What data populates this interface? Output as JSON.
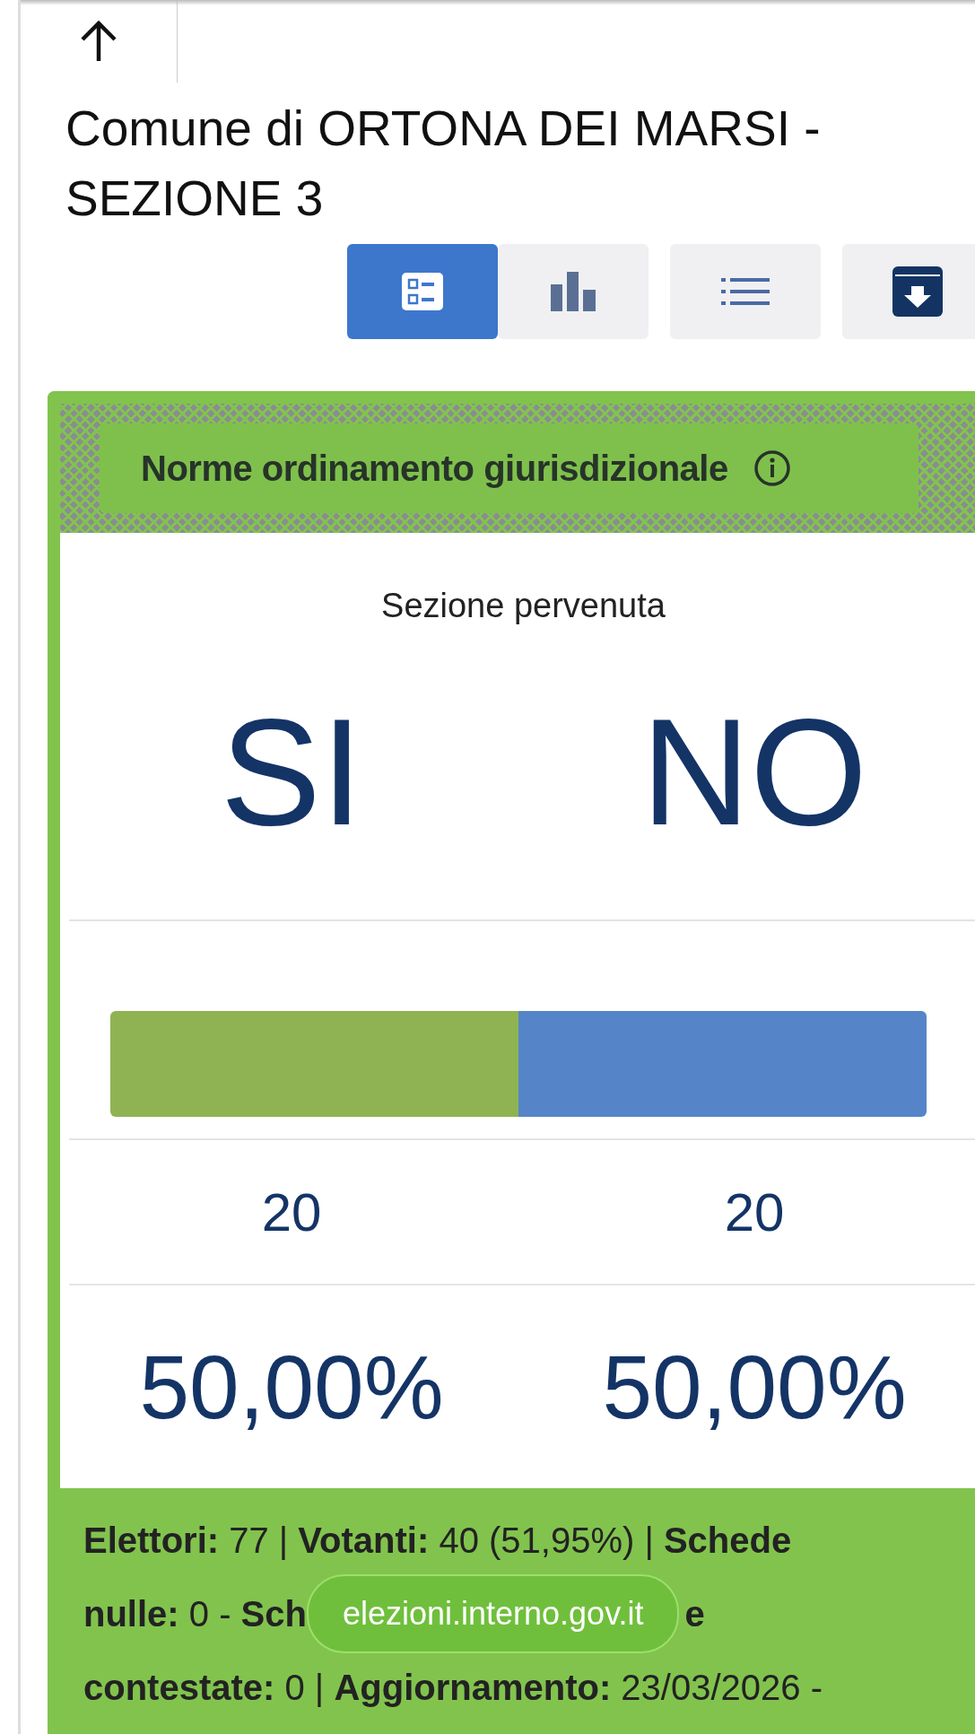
{
  "title": "Comune di ORTONA DEI MARSI - SEZIONE 3",
  "toolbar": [
    {
      "kind": "summary",
      "selected": true
    },
    {
      "kind": "chart",
      "selected": false
    },
    {
      "kind": "list",
      "selected": false
    },
    {
      "kind": "download",
      "selected": false
    }
  ],
  "card": {
    "header": "Norme ordinamento giurisdizionale",
    "status": "Sezione pervenuta",
    "options": [
      {
        "label": "SI",
        "votes": "20",
        "percent": "50,00%",
        "color": "#8fb352"
      },
      {
        "label": "NO",
        "votes": "20",
        "percent": "50,00%",
        "color": "#5585c8"
      }
    ],
    "bar": {
      "level": 0.5
    },
    "footer": {
      "lines": [
        {
          "text": "**Elettori:** 77 | **Votanti:** 40 (51,95%) | **Schede**"
        },
        {
          "text": "**nulle:** 0 - **Sch**",
          "after": "**e**"
        },
        {
          "text": "**contestate:** 0 | **Aggiornamento:** 23/03/2026 -"
        }
      ]
    }
  },
  "url_toast": {
    "text": "elezioni.interno.gov.it"
  }
}
